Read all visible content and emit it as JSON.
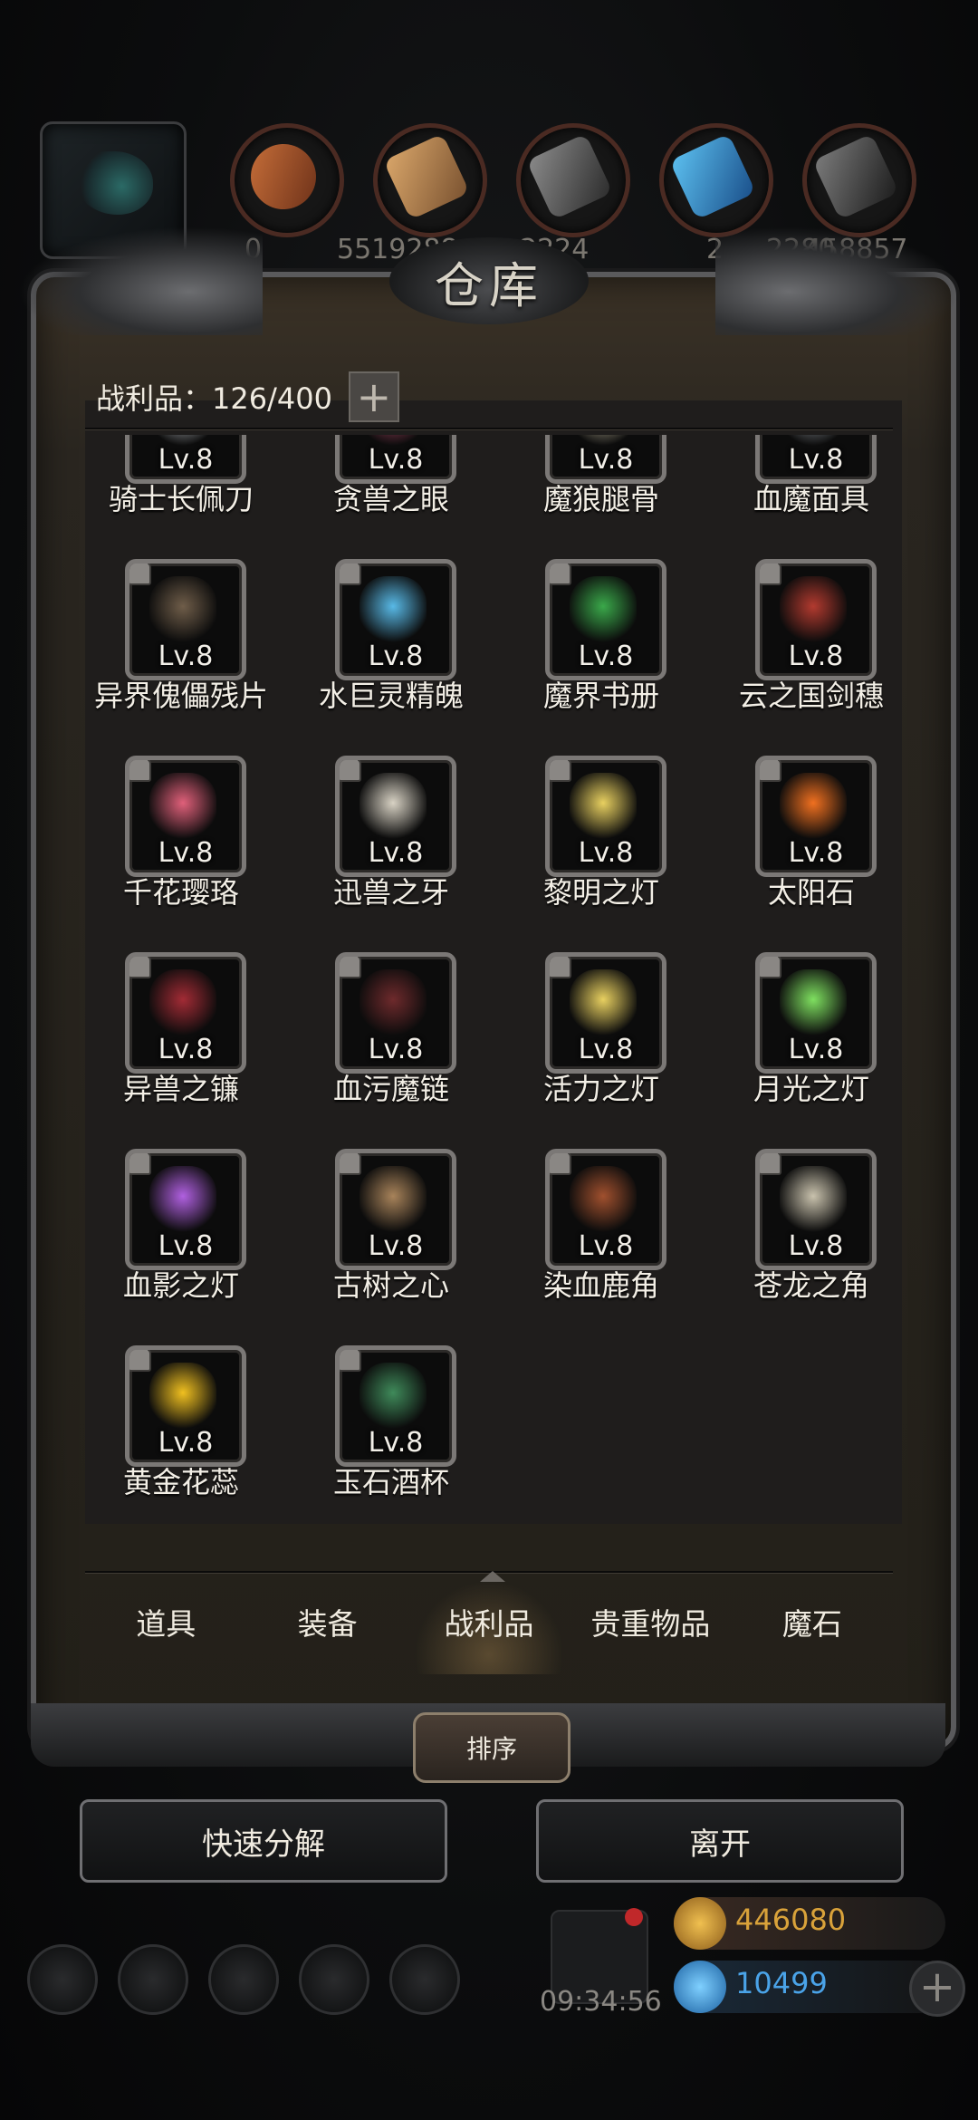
{
  "resources": {
    "numbers": [
      "0",
      "5519288",
      "2224",
      "2",
      "2280",
      "458857"
    ]
  },
  "panel": {
    "title": "仓库",
    "count_label": "战利品：126/400",
    "plus_symbol": "+"
  },
  "items": [
    {
      "name": "骑士长佩刀",
      "level": "Lv.8",
      "icon": "sword-icon",
      "color": "#c7cbd0"
    },
    {
      "name": "贪兽之眼",
      "level": "Lv.8",
      "icon": "beast-eye-icon",
      "color": "#b54b6a"
    },
    {
      "name": "魔狼腿骨",
      "level": "Lv.8",
      "icon": "bone-icon",
      "color": "#c9c1a6"
    },
    {
      "name": "血魔面具",
      "level": "Lv.8",
      "icon": "mask-icon",
      "color": "#9aa0a6"
    },
    {
      "name": "异界傀儡残片",
      "level": "Lv.8",
      "icon": "shard-icon",
      "color": "#6f5d49"
    },
    {
      "name": "水巨灵精魄",
      "level": "Lv.8",
      "icon": "water-spirit-icon",
      "color": "#58b9e6"
    },
    {
      "name": "魔界书册",
      "level": "Lv.8",
      "icon": "book-icon",
      "color": "#3aa84a"
    },
    {
      "name": "云之国剑穗",
      "level": "Lv.8",
      "icon": "tassel-icon",
      "color": "#b23a2f"
    },
    {
      "name": "千花璎珞",
      "level": "Lv.8",
      "icon": "necklace-icon",
      "color": "#e0607a"
    },
    {
      "name": "迅兽之牙",
      "level": "Lv.8",
      "icon": "fang-icon",
      "color": "#d8d2c4"
    },
    {
      "name": "黎明之灯",
      "level": "Lv.8",
      "icon": "lantern-icon",
      "color": "#e8d060"
    },
    {
      "name": "太阳石",
      "level": "Lv.8",
      "icon": "sun-stone-icon",
      "color": "#f07020"
    },
    {
      "name": "异兽之镰",
      "level": "Lv.8",
      "icon": "scythe-icon",
      "color": "#a22b35"
    },
    {
      "name": "血污魔链",
      "level": "Lv.8",
      "icon": "chain-icon",
      "color": "#6e2a2c"
    },
    {
      "name": "活力之灯",
      "level": "Lv.8",
      "icon": "lantern-icon",
      "color": "#e8d060"
    },
    {
      "name": "月光之灯",
      "level": "Lv.8",
      "icon": "lantern-icon",
      "color": "#7fe060"
    },
    {
      "name": "血影之灯",
      "level": "Lv.8",
      "icon": "lantern-icon",
      "color": "#b060e0"
    },
    {
      "name": "古树之心",
      "level": "Lv.8",
      "icon": "tree-root-icon",
      "color": "#a8835a"
    },
    {
      "name": "染血鹿角",
      "level": "Lv.8",
      "icon": "antler-icon",
      "color": "#a0502e"
    },
    {
      "name": "苍龙之角",
      "level": "Lv.8",
      "icon": "dragon-horn-icon",
      "color": "#c9c2ad"
    },
    {
      "name": "黄金花蕊",
      "level": "Lv.8",
      "icon": "golden-flower-icon",
      "color": "#f0c020"
    },
    {
      "name": "玉石酒杯",
      "level": "Lv.8",
      "icon": "jade-cup-icon",
      "color": "#3f8a5a"
    }
  ],
  "tabs": [
    {
      "label": "道具"
    },
    {
      "label": "装备"
    },
    {
      "label": "战利品",
      "active": true
    },
    {
      "label": "贵重物品"
    },
    {
      "label": "魔石"
    }
  ],
  "buttons": {
    "sort": "排序",
    "quick_decompose": "快速分解",
    "leave": "离开"
  },
  "bottom_bar": {
    "timer": "09:34:56",
    "gold": "446080",
    "diamond": "10499",
    "plus_symbol": "+"
  },
  "colors": {
    "gold_text": "#d9a23a",
    "diamond_text": "#4aa3e8"
  }
}
